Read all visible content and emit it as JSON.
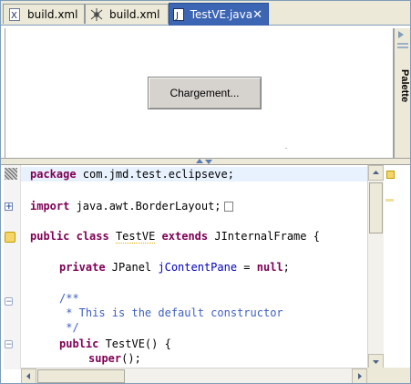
{
  "tabs": [
    {
      "label": "build.xml",
      "icon": "xml-file-icon"
    },
    {
      "label": "build.xml",
      "icon": "ant-build-icon"
    },
    {
      "label": "TestVE.java",
      "icon": "java-file-icon",
      "close": "✕"
    }
  ],
  "designer": {
    "button_label": "Chargement..."
  },
  "palette": {
    "label": "Palette"
  },
  "code": {
    "l1": {
      "kw": "package",
      "rest": " com.jmd.test.eclipseve;"
    },
    "l2": {
      "kw": "import",
      "rest": " java.awt.BorderLayout;"
    },
    "l3": {
      "kw1": "public",
      "kw2": "class",
      "name": "TestVE",
      "kw3": "extends",
      "rest": " JInternalFrame {"
    },
    "l4": {
      "kw1": "private",
      "mid": " JPanel ",
      "field": "jContentPane",
      "eq": " = ",
      "kw2": "null",
      "end": ";"
    },
    "l5": "/**",
    "l6": " * This is the default constructor",
    "l7": " */",
    "l8": {
      "kw": "public",
      "rest": " TestVE() {"
    },
    "l9": {
      "kw": "super",
      "rest": "();"
    }
  }
}
